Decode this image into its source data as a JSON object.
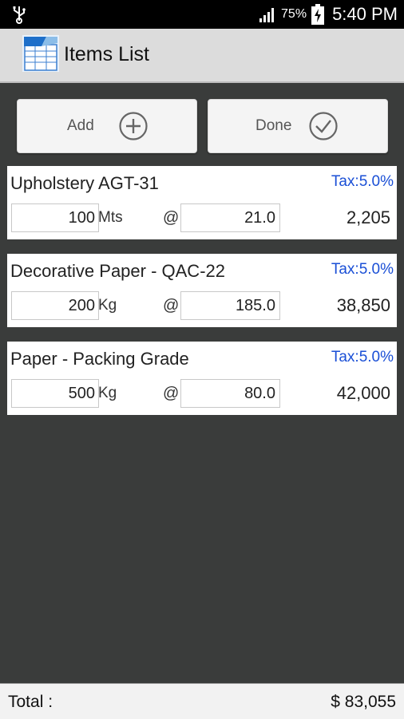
{
  "status_bar": {
    "usb_icon": "usb-icon",
    "signal_icon": "signal-bars-icon",
    "battery_percent": "75%",
    "battery_icon": "battery-charging-icon",
    "time": "5:40 PM"
  },
  "action_bar": {
    "app_icon": "invoice-app-icon",
    "title": "Items List"
  },
  "buttons": {
    "add_label": "Add",
    "add_icon": "plus-circle-icon",
    "done_label": "Done",
    "done_icon": "check-circle-icon"
  },
  "items": [
    {
      "name": "Upholstery AGT-31",
      "tax": "Tax:5.0%",
      "quantity": "100",
      "unit": "Mts",
      "at": "@",
      "price": "21.0",
      "amount": "2,205"
    },
    {
      "name": "Decorative Paper - QAC-22",
      "tax": "Tax:5.0%",
      "quantity": "200",
      "unit": "Kg",
      "at": "@",
      "price": "185.0",
      "amount": "38,850"
    },
    {
      "name": "Paper - Packing Grade",
      "tax": "Tax:5.0%",
      "quantity": "500",
      "unit": "Kg",
      "at": "@",
      "price": "80.0",
      "amount": "42,000"
    }
  ],
  "footer": {
    "total_label": "Total :",
    "total_value": "$ 83,055"
  },
  "colors": {
    "background": "#3a3c3b",
    "tax_text": "#1a4fd6",
    "card": "#ffffff"
  }
}
